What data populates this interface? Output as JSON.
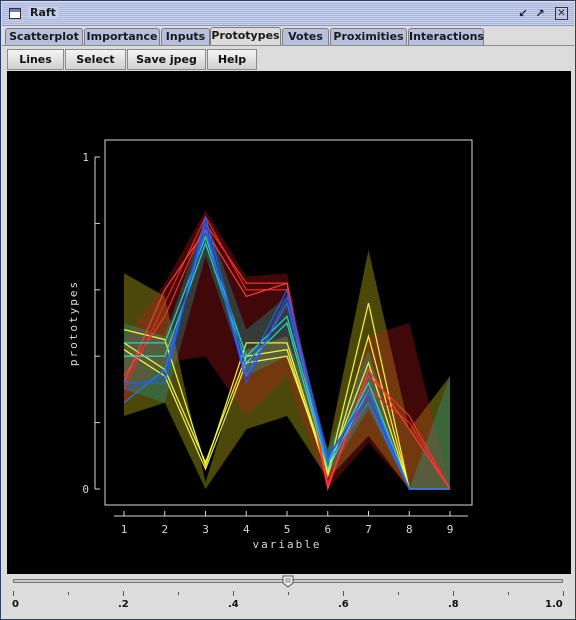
{
  "window": {
    "title": "Raft"
  },
  "titlebar_buttons": [
    "minimize-icon",
    "maximize-icon",
    "close-icon"
  ],
  "tabs": [
    {
      "label": "Scatterplot",
      "active": false
    },
    {
      "label": "Importance",
      "active": false
    },
    {
      "label": "Inputs",
      "active": false
    },
    {
      "label": "Prototypes",
      "active": true
    },
    {
      "label": "Votes",
      "active": false
    },
    {
      "label": "Proximities",
      "active": false
    },
    {
      "label": "Interactions",
      "active": false
    }
  ],
  "toolbar": {
    "lines": "Lines",
    "select": "Select",
    "save": "Save jpeg",
    "help": "Help"
  },
  "slider": {
    "value": 0.5,
    "labels": [
      "0",
      ".2",
      ".4",
      ".6",
      ".8",
      "1.0"
    ]
  },
  "chart_data": {
    "type": "line",
    "xlabel": "variable",
    "ylabel": "prototypes",
    "x": [
      1,
      2,
      3,
      4,
      5,
      6,
      7,
      8,
      9
    ],
    "x_ticks": [
      "1",
      "2",
      "3",
      "4",
      "5",
      "6",
      "7",
      "8",
      "9"
    ],
    "y_ticks": [
      "0",
      "1"
    ],
    "ylim": [
      0,
      1
    ],
    "grid": false,
    "background": "#000000",
    "bands": [
      {
        "color": "#e8e020",
        "upper": [
          0.65,
          0.58,
          0.02,
          0.42,
          0.46,
          0.12,
          0.72,
          0.18,
          0.34
        ],
        "lower": [
          0.22,
          0.26,
          0.0,
          0.18,
          0.22,
          0.03,
          0.16,
          0.0,
          0.0
        ]
      },
      {
        "color": "#c81818",
        "upper": [
          0.45,
          0.62,
          0.84,
          0.64,
          0.65,
          0.06,
          0.46,
          0.5,
          0.0
        ],
        "lower": [
          0.26,
          0.38,
          0.4,
          0.22,
          0.34,
          0.0,
          0.14,
          0.0,
          0.0
        ]
      },
      {
        "color": "#20a8a0",
        "upper": [
          0.5,
          0.46,
          0.82,
          0.48,
          0.58,
          0.12,
          0.42,
          0.0,
          0.34
        ],
        "lower": [
          0.3,
          0.26,
          0.7,
          0.34,
          0.4,
          0.04,
          0.24,
          0.0,
          0.0
        ]
      }
    ],
    "series": [
      {
        "color": "#ffff40",
        "values": [
          0.48,
          0.45,
          0.07,
          0.44,
          0.44,
          0.05,
          0.56,
          0.0,
          0.0
        ]
      },
      {
        "color": "#ffff40",
        "values": [
          0.44,
          0.36,
          0.08,
          0.4,
          0.42,
          0.04,
          0.46,
          0.0,
          0.0
        ]
      },
      {
        "color": "#ffff40",
        "values": [
          0.42,
          0.34,
          0.06,
          0.38,
          0.4,
          0.06,
          0.38,
          0.0,
          0.0
        ]
      },
      {
        "color": "#ff3030",
        "values": [
          0.34,
          0.52,
          0.8,
          0.62,
          0.62,
          0.01,
          0.34,
          0.22,
          0.0
        ]
      },
      {
        "color": "#ff2020",
        "values": [
          0.3,
          0.56,
          0.82,
          0.6,
          0.6,
          0.02,
          0.3,
          0.2,
          0.0
        ]
      },
      {
        "color": "#ff4040",
        "values": [
          0.32,
          0.6,
          0.78,
          0.58,
          0.62,
          0.0,
          0.36,
          0.18,
          0.0
        ]
      },
      {
        "color": "#20e0d0",
        "values": [
          0.44,
          0.44,
          0.76,
          0.4,
          0.52,
          0.08,
          0.32,
          0.0,
          0.0
        ]
      },
      {
        "color": "#20e0d0",
        "values": [
          0.4,
          0.4,
          0.74,
          0.38,
          0.5,
          0.06,
          0.3,
          0.0,
          0.0
        ]
      },
      {
        "color": "#2050ff",
        "values": [
          0.3,
          0.34,
          0.8,
          0.32,
          0.58,
          0.1,
          0.28,
          0.0,
          0.0
        ]
      },
      {
        "color": "#3070ff",
        "values": [
          0.26,
          0.36,
          0.78,
          0.34,
          0.56,
          0.08,
          0.26,
          0.0,
          0.0
        ]
      },
      {
        "color": "#2060f0",
        "values": [
          0.32,
          0.32,
          0.82,
          0.36,
          0.6,
          0.09,
          0.3,
          0.0,
          0.0
        ]
      }
    ]
  }
}
